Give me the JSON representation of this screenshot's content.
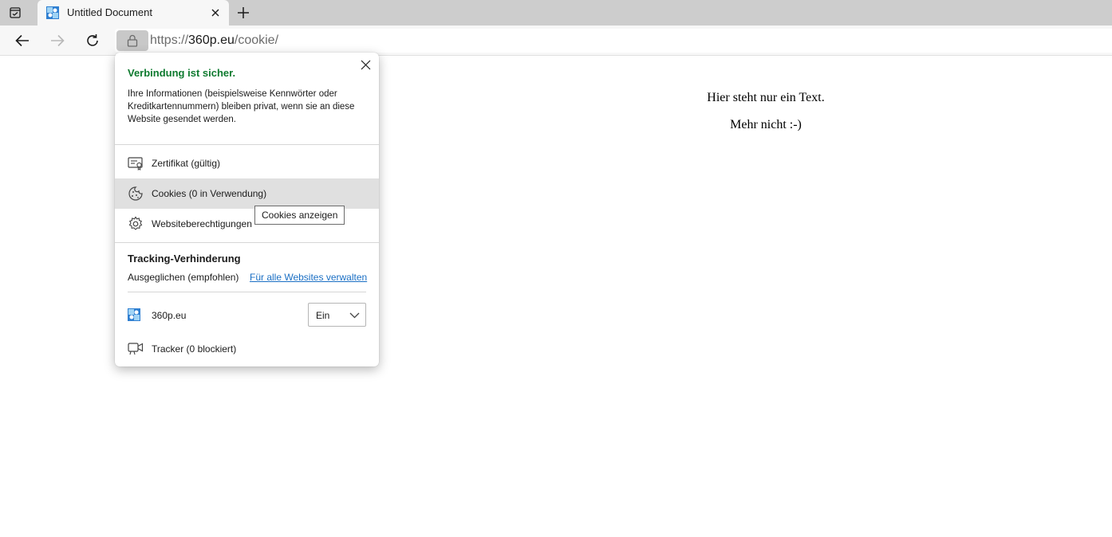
{
  "browser": {
    "tab": {
      "title": "Untitled Document"
    },
    "address": {
      "scheme": "https://",
      "host": "360p.eu",
      "path": "/cookie/"
    }
  },
  "page": {
    "line1": "Hier steht nur ein Text.",
    "line2": "Mehr nicht :-)"
  },
  "site_info_flyout": {
    "heading": "Verbindung ist sicher.",
    "description": "Ihre Informationen (beispielsweise Kennwörter oder Kreditkartennummern) bleiben privat, wenn sie an diese Website gesendet werden.",
    "items": [
      {
        "label": "Zertifikat (gültig)",
        "icon": "certificate-icon"
      },
      {
        "label": "Cookies (0 in Verwendung)",
        "icon": "cookie-icon"
      },
      {
        "label": "Websiteberechtigungen",
        "icon": "gear-icon"
      }
    ],
    "tracking": {
      "heading": "Tracking-Verhinderung",
      "level": "Ausgeglichen (empfohlen)",
      "manage_link": "Für alle Websites verwalten",
      "site": "360p.eu",
      "state": "Ein",
      "trackers": "Tracker (0 blockiert)"
    }
  },
  "tooltip": "Cookies anzeigen",
  "colors": {
    "secure_green": "#0e7a2f",
    "link_blue": "#1a6fc4",
    "hover_gray": "#e0e0e0"
  }
}
